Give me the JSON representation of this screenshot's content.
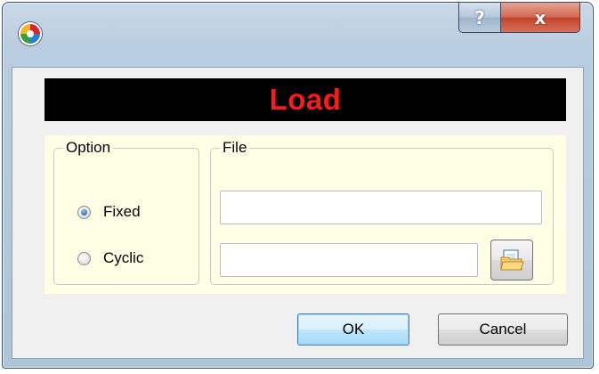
{
  "titlebar": {
    "app_icon": "app-logo-icon",
    "help_label": "?",
    "close_label": "x"
  },
  "banner": {
    "title": "Load",
    "title_color": "#ff1a1a",
    "background": "#000000"
  },
  "panel_background": "#ffffe6",
  "option_group": {
    "legend": "Option",
    "options": [
      {
        "label": "Fixed",
        "checked": true
      },
      {
        "label": "Cyclic",
        "checked": false
      }
    ]
  },
  "file_group": {
    "legend": "File",
    "field1_value": "",
    "field2_value": "",
    "browse_icon": "open-folder-icon"
  },
  "buttons": {
    "ok_label": "OK",
    "cancel_label": "Cancel"
  }
}
